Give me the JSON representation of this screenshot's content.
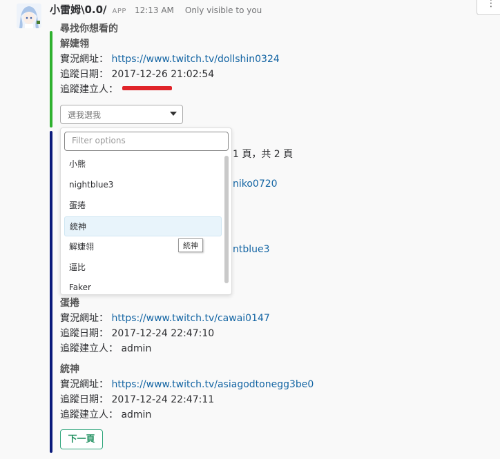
{
  "message": {
    "username": "小雷姆\\0.0/",
    "app_badge": "APP",
    "timestamp": "12:13 AM",
    "visibility": "Only visible to you",
    "more_label": "⋮",
    "avatar_icon": "anime-avatar-icon"
  },
  "colors": {
    "accent_green": "#2fb12f",
    "accent_navy": "#0b1b7c",
    "link": "#1264a3",
    "redaction": "#e0242a"
  },
  "attachment1": {
    "title": "尋找你想看的",
    "name": "解婕翎",
    "url_label": "實況網址：",
    "url": "https://www.twitch.tv/dollshin0324",
    "date_label": "追蹤日期：",
    "date": "2017-12-26 21:02:54",
    "creator_label": "追蹤建立人："
  },
  "select": {
    "placeholder": "選我選我",
    "filter_placeholder": "Filter options",
    "options": [
      "小熊",
      "nightblue3",
      "蛋捲",
      "統神",
      "解婕翎",
      "逼比",
      "Faker"
    ],
    "highlighted_index": 3,
    "tooltip": "統神"
  },
  "attachment2": {
    "page_info_partial": "1 頁，共 2 頁",
    "link_partial_1": "niko0720",
    "link_partial_2": "ntblue3",
    "entries": [
      {
        "name": "蛋捲",
        "url_label": "實況網址：",
        "url": "https://www.twitch.tv/cawai0147",
        "date_label": "追蹤日期：",
        "date": "2017-12-24 22:47:10",
        "creator_label": "追蹤建立人：",
        "creator": "admin"
      },
      {
        "name": "統神",
        "url_label": "實況網址：",
        "url": "https://www.twitch.tv/asiagodtonegg3be0",
        "date_label": "追蹤日期：",
        "date": "2017-12-24 22:47:11",
        "creator_label": "追蹤建立人：",
        "creator": "admin"
      }
    ],
    "next_button": "下一頁"
  }
}
